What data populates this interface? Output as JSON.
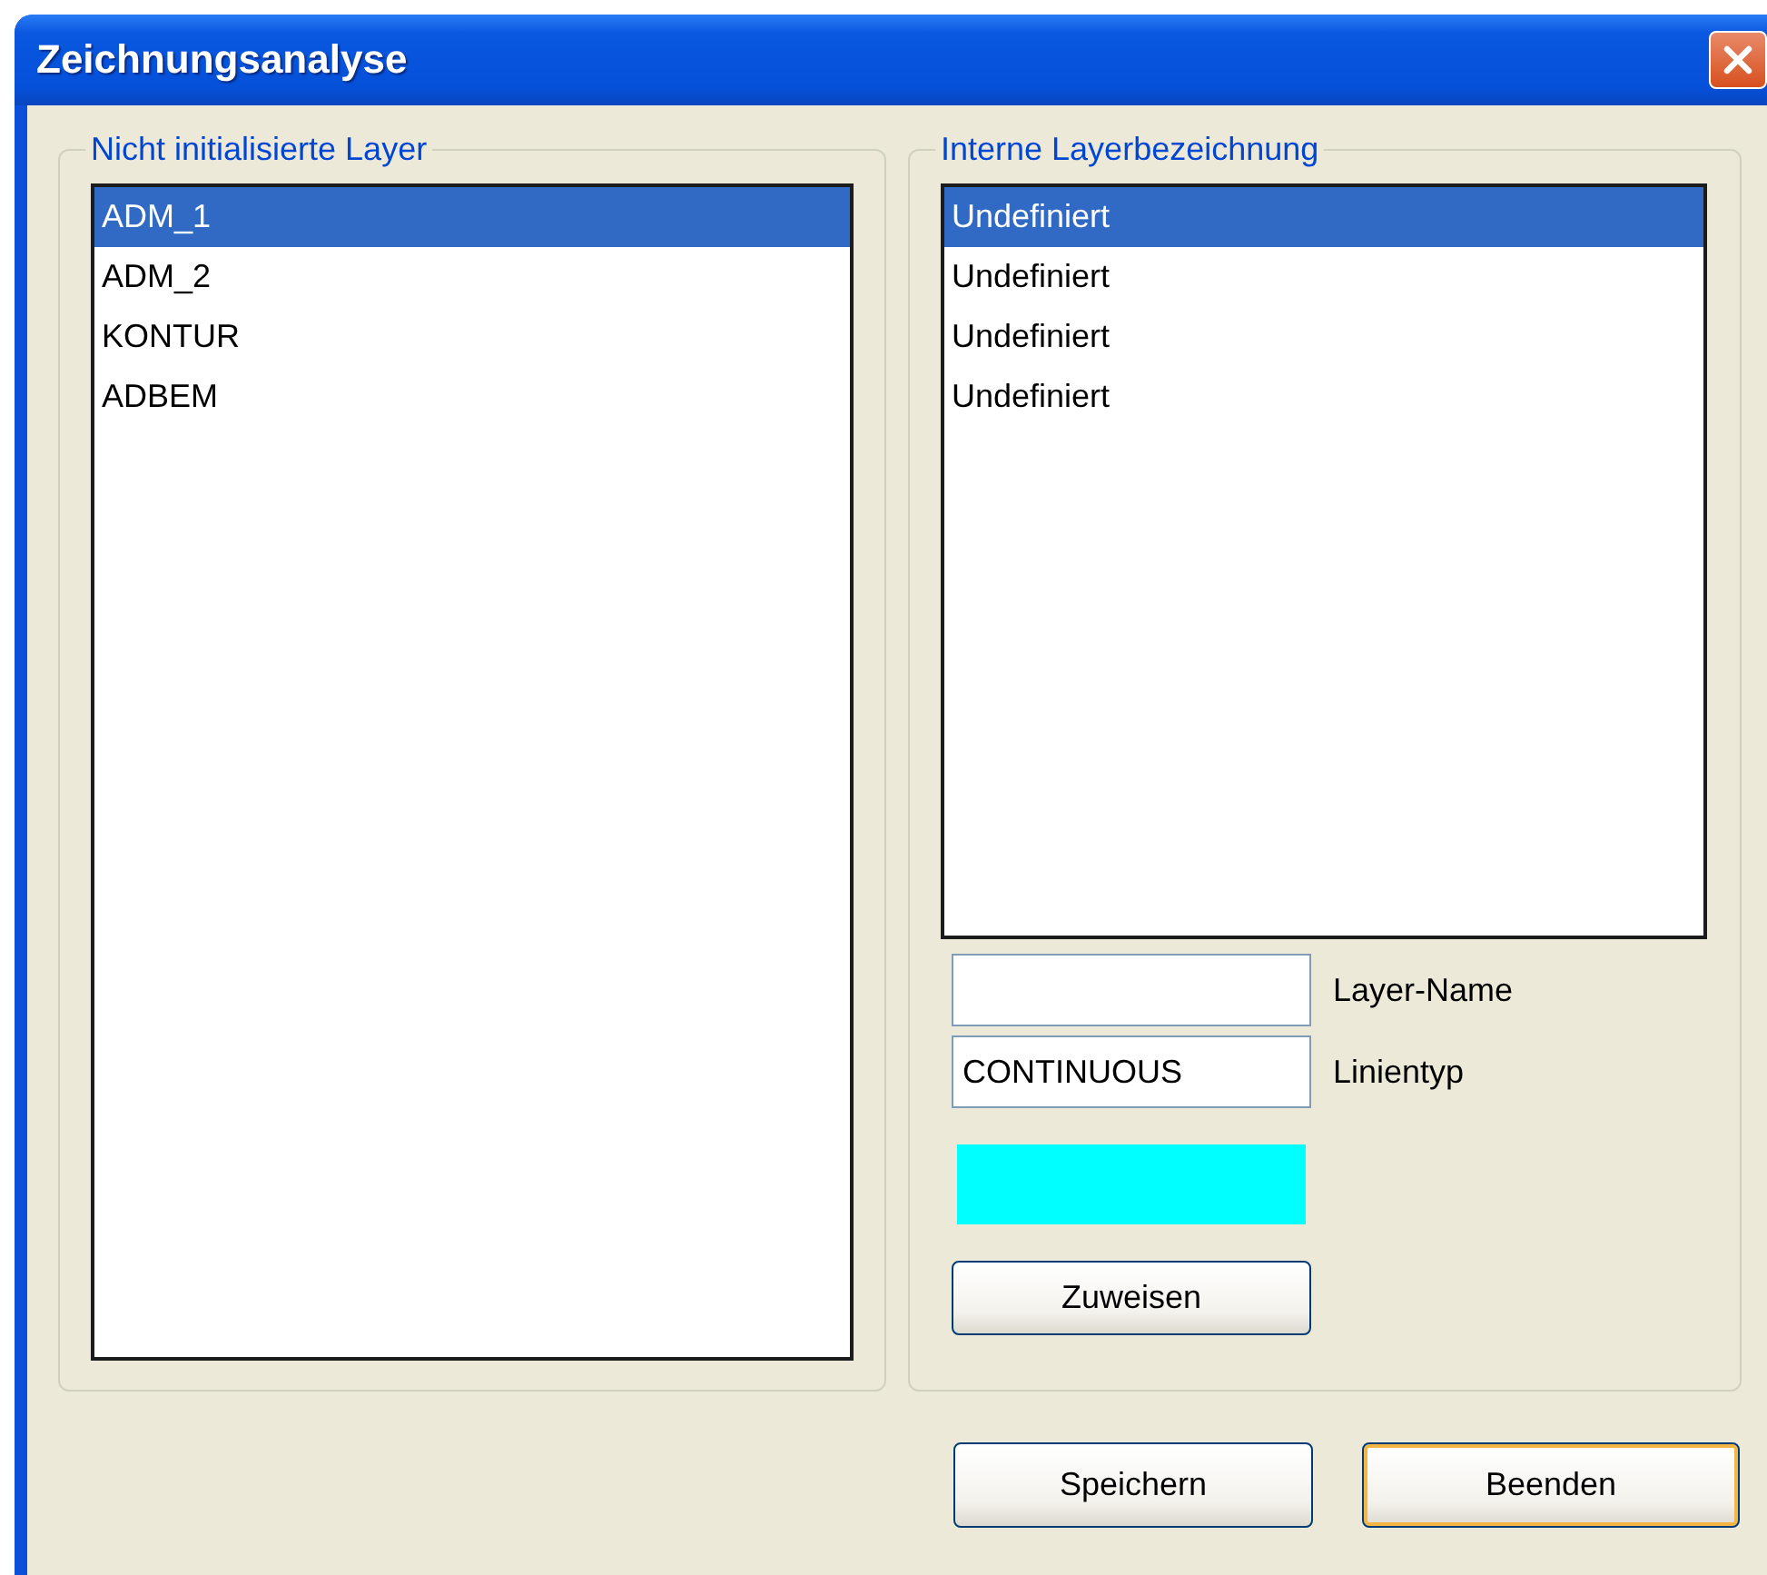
{
  "window": {
    "title": "Zeichnungsanalyse"
  },
  "left_group": {
    "legend": "Nicht initialisierte Layer",
    "items": [
      {
        "label": "ADM_1",
        "selected": true
      },
      {
        "label": "ADM_2",
        "selected": false
      },
      {
        "label": "KONTUR",
        "selected": false
      },
      {
        "label": "ADBEM",
        "selected": false
      }
    ]
  },
  "right_group": {
    "legend": "Interne Layerbezeichnung",
    "items": [
      {
        "label": "Undefiniert",
        "selected": true
      },
      {
        "label": "Undefiniert",
        "selected": false
      },
      {
        "label": "Undefiniert",
        "selected": false
      },
      {
        "label": "Undefiniert",
        "selected": false
      }
    ],
    "fields": [
      {
        "label": "Layer-Name"
      },
      {
        "label": "Linientyp",
        "value": "CONTINUOUS"
      }
    ],
    "color_swatch": {
      "color": "#00ffff"
    },
    "assign_button": "Zuweisen"
  },
  "buttons": [
    {
      "label": "Speichern",
      "default": false
    },
    {
      "label": "Beenden",
      "default": true
    }
  ]
}
